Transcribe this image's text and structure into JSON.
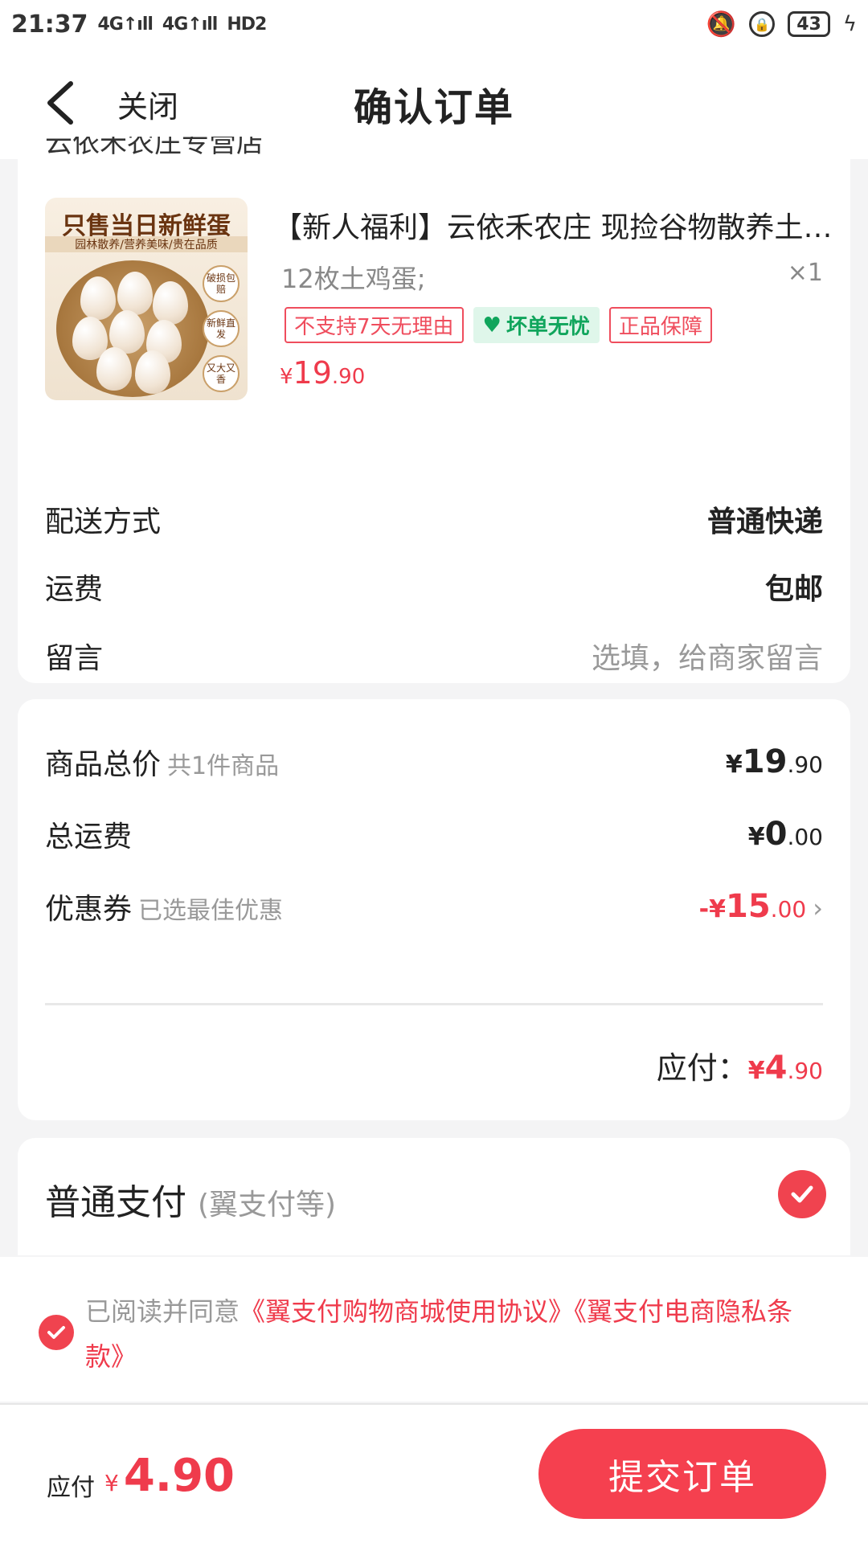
{
  "status_bar": {
    "time": "21:37",
    "signal1": "4G↑ıll",
    "signal2": "4G↑ıll",
    "hd": "HD2",
    "battery": "43",
    "icons": [
      "mute-icon",
      "lock-icon",
      "battery-icon",
      "charging-icon"
    ]
  },
  "nav": {
    "close_label": "关闭",
    "title": "确认订单"
  },
  "order": {
    "shop_name_cut": "云依禾农庄专营店",
    "product": {
      "image_text_main": "只售当日新鲜蛋",
      "image_text_sub": "园林散养/营养美味/贵在品质",
      "image_bubbles": [
        "破损包赔",
        "新鲜直发",
        "又大又香"
      ],
      "title": "【新人福利】云依禾农庄 现捡谷物散养土鸡蛋",
      "spec": "12枚土鸡蛋;",
      "qty": "×1",
      "badges": {
        "no_return": "不支持7天无理由",
        "bad_egg": "坏单无忧",
        "genuine": "正品保障"
      },
      "price_symbol": "¥",
      "price_int": "19",
      "price_dec": ".90"
    },
    "delivery": {
      "label": "配送方式",
      "value": "普通快递"
    },
    "shipping": {
      "label": "运费",
      "value": "包邮"
    },
    "message": {
      "label": "留言",
      "placeholder": "选填，给商家留言"
    }
  },
  "summary": {
    "goods_total": {
      "label": "商品总价",
      "sub": "共1件商品",
      "symbol": "¥",
      "int": "19",
      "dec": ".90"
    },
    "shipping_total": {
      "label": "总运费",
      "symbol": "¥",
      "int": "0",
      "dec": ".00"
    },
    "coupon": {
      "label": "优惠券",
      "sub": "已选最佳优惠",
      "symbol": "-¥",
      "int": "15",
      "dec": ".00"
    },
    "due": {
      "label": "应付：",
      "symbol": "¥",
      "int": "4",
      "dec": ".90"
    }
  },
  "payment": {
    "label": "普通支付",
    "sub": "(翼支付等)",
    "selected": true
  },
  "agreement": {
    "prefix": "已阅读并同意",
    "link1": "《翼支付购物商城使用协议》",
    "link2": "《翼支付电商隐私条款》",
    "checked": true
  },
  "bottom": {
    "due_label": "应付",
    "currency": "¥",
    "amount": "4.90",
    "submit_label": "提交订单"
  },
  "colors": {
    "accent": "#f5404f",
    "price_red": "#ef3b4c",
    "green_badge": "#10a55c"
  }
}
